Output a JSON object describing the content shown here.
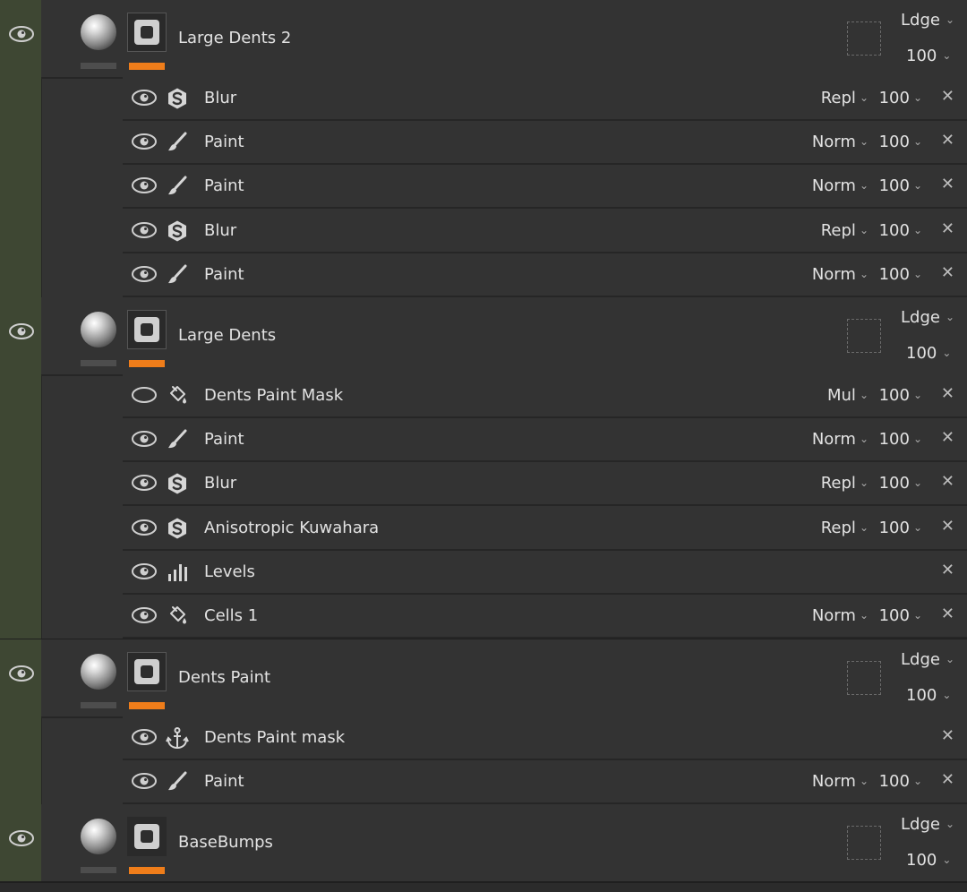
{
  "groups": [
    {
      "name": "Large Dents 2",
      "blend": "Ldge",
      "opacity": "100",
      "items": [
        {
          "name": "Blur",
          "icon": "substance-icon",
          "blend": "Repl",
          "opacity": "100"
        },
        {
          "name": "Paint",
          "icon": "brush-icon",
          "blend": "Norm",
          "opacity": "100"
        },
        {
          "name": "Paint",
          "icon": "brush-icon",
          "blend": "Norm",
          "opacity": "100"
        },
        {
          "name": "Blur",
          "icon": "substance-icon",
          "blend": "Repl",
          "opacity": "100"
        },
        {
          "name": "Paint",
          "icon": "brush-icon",
          "blend": "Norm",
          "opacity": "100"
        }
      ]
    },
    {
      "name": "Large Dents",
      "blend": "Ldge",
      "opacity": "100",
      "items": [
        {
          "name": "Dents Paint Mask",
          "icon": "fill-bucket-icon",
          "blend": "Mul",
          "opacity": "100",
          "hidden": true
        },
        {
          "name": "Paint",
          "icon": "brush-icon",
          "blend": "Norm",
          "opacity": "100"
        },
        {
          "name": "Blur",
          "icon": "substance-icon",
          "blend": "Repl",
          "opacity": "100"
        },
        {
          "name": "Anisotropic Kuwahara",
          "icon": "substance-icon",
          "blend": "Repl",
          "opacity": "100"
        },
        {
          "name": "Levels",
          "icon": "levels-icon",
          "blend": "",
          "opacity": ""
        },
        {
          "name": "Cells 1",
          "icon": "fill-bucket-icon",
          "blend": "Norm",
          "opacity": "100"
        }
      ]
    },
    {
      "name": "Dents Paint",
      "blend": "Ldge",
      "opacity": "100",
      "items": [
        {
          "name": "Dents Paint mask",
          "icon": "anchor-icon",
          "blend": "",
          "opacity": ""
        },
        {
          "name": "Paint",
          "icon": "brush-icon",
          "blend": "Norm",
          "opacity": "100"
        }
      ]
    },
    {
      "name": "BaseBumps",
      "blend": "Ldge",
      "opacity": "100",
      "items": []
    }
  ],
  "colors": {
    "group_strip": "#3e4733",
    "mask_accent": "#ef7d1a",
    "row_bg": "#333333",
    "divider": "#262626"
  }
}
